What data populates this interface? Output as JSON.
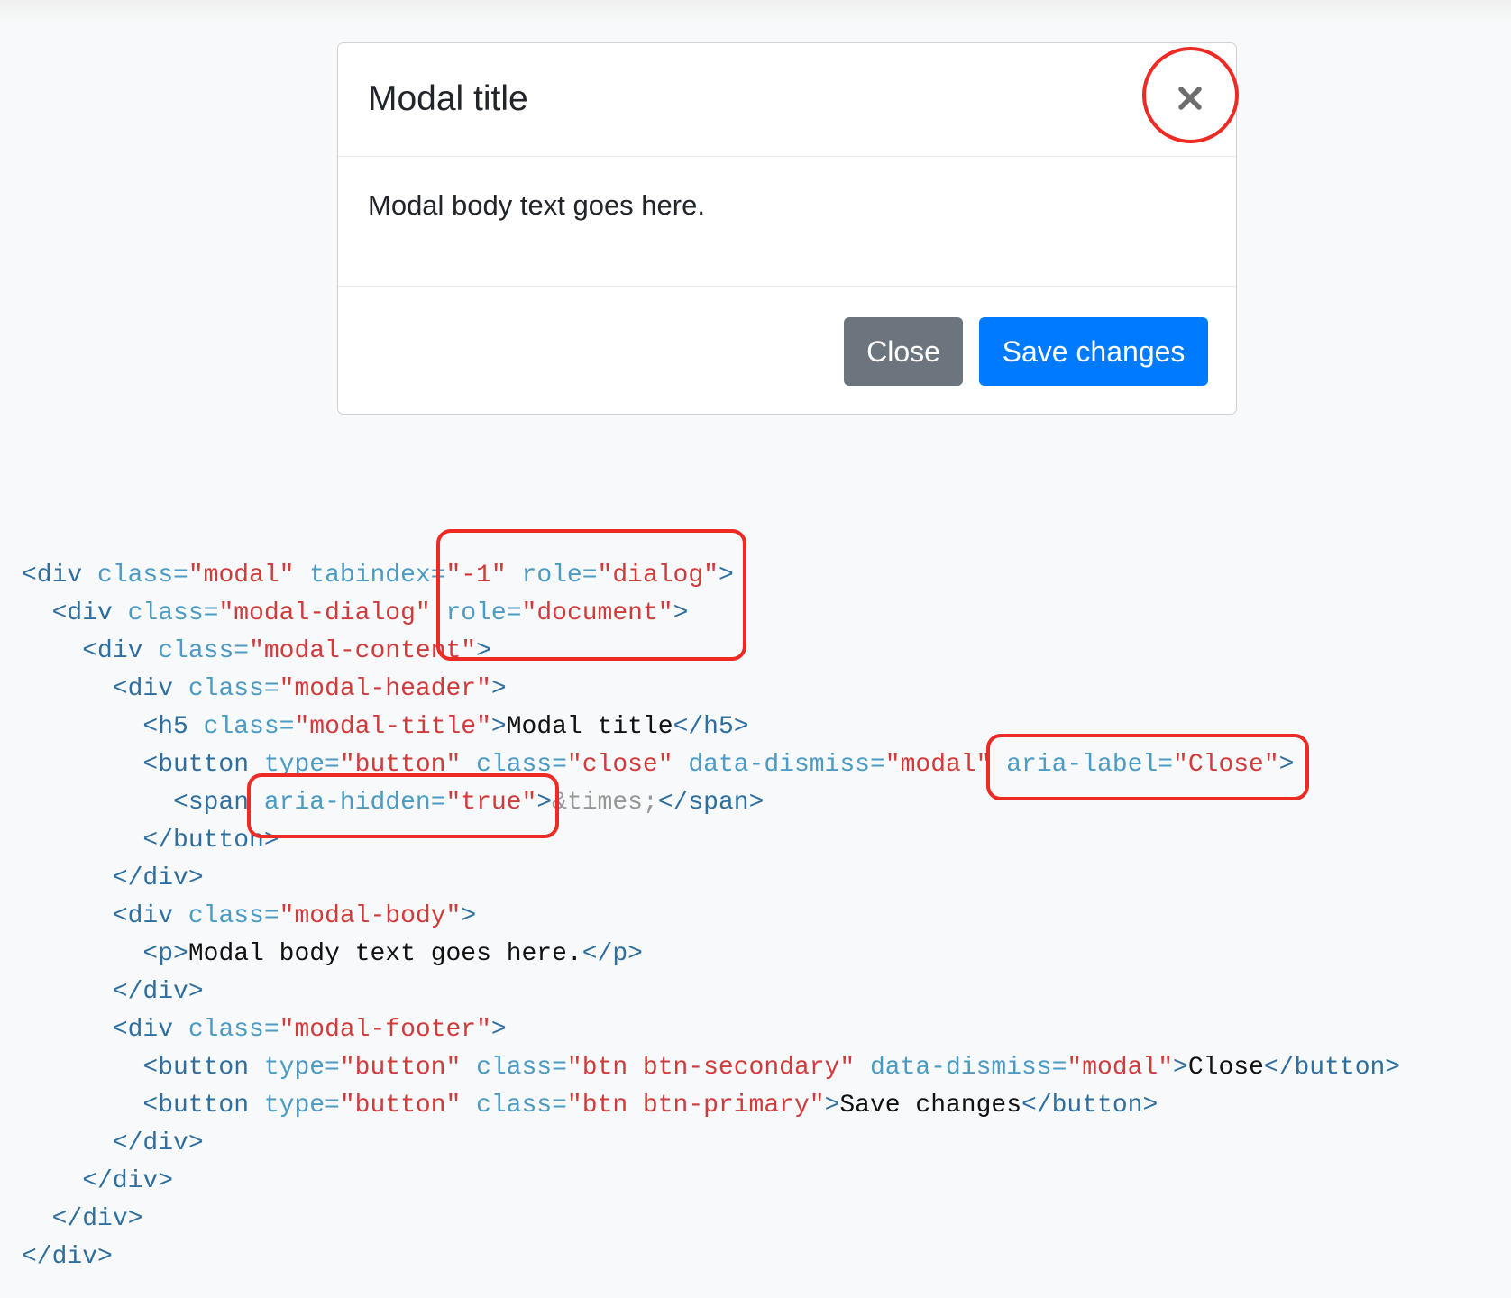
{
  "modal": {
    "title": "Modal title",
    "body_text": "Modal body text goes here.",
    "close_icon": "close-icon",
    "buttons": {
      "close": "Close",
      "save": "Save changes"
    },
    "colors": {
      "secondary": "#6c757d",
      "primary": "#007bff",
      "highlight": "#ee2a24"
    }
  },
  "code": {
    "lines": [
      [
        [
          "t",
          "<div "
        ],
        [
          "a",
          "class="
        ],
        [
          "s",
          "\"modal\""
        ],
        [
          "a",
          " tabindex="
        ],
        [
          "s",
          "\"-1\""
        ],
        [
          "a",
          " role="
        ],
        [
          "s",
          "\"dialog\""
        ],
        [
          "t",
          ">"
        ]
      ],
      [
        [
          "x",
          "  "
        ],
        [
          "t",
          "<div "
        ],
        [
          "a",
          "class="
        ],
        [
          "s",
          "\"modal-dialog\""
        ],
        [
          "a",
          " role="
        ],
        [
          "s",
          "\"document\""
        ],
        [
          "t",
          ">"
        ]
      ],
      [
        [
          "x",
          "    "
        ],
        [
          "t",
          "<div "
        ],
        [
          "a",
          "class="
        ],
        [
          "s",
          "\"modal-content\""
        ],
        [
          "t",
          ">"
        ]
      ],
      [
        [
          "x",
          "      "
        ],
        [
          "t",
          "<div "
        ],
        [
          "a",
          "class="
        ],
        [
          "s",
          "\"modal-header\""
        ],
        [
          "t",
          ">"
        ]
      ],
      [
        [
          "x",
          "        "
        ],
        [
          "t",
          "<h5 "
        ],
        [
          "a",
          "class="
        ],
        [
          "s",
          "\"modal-title\""
        ],
        [
          "t",
          ">"
        ],
        [
          "x",
          "Modal title"
        ],
        [
          "t",
          "</h5>"
        ]
      ],
      [
        [
          "x",
          "        "
        ],
        [
          "t",
          "<button "
        ],
        [
          "a",
          "type="
        ],
        [
          "s",
          "\"button\""
        ],
        [
          "a",
          " class="
        ],
        [
          "s",
          "\"close\""
        ],
        [
          "a",
          " data-dismiss="
        ],
        [
          "s",
          "\"modal\""
        ],
        [
          "a",
          " aria-label="
        ],
        [
          "s",
          "\"Close\""
        ],
        [
          "t",
          ">"
        ]
      ],
      [
        [
          "x",
          "          "
        ],
        [
          "t",
          "<span "
        ],
        [
          "a",
          "aria-hidden="
        ],
        [
          "s",
          "\"true\""
        ],
        [
          "t",
          ">"
        ],
        [
          "e",
          "&times;"
        ],
        [
          "t",
          "</span>"
        ]
      ],
      [
        [
          "x",
          "        "
        ],
        [
          "t",
          "</button>"
        ]
      ],
      [
        [
          "x",
          "      "
        ],
        [
          "t",
          "</div>"
        ]
      ],
      [
        [
          "x",
          "      "
        ],
        [
          "t",
          "<div "
        ],
        [
          "a",
          "class="
        ],
        [
          "s",
          "\"modal-body\""
        ],
        [
          "t",
          ">"
        ]
      ],
      [
        [
          "x",
          "        "
        ],
        [
          "t",
          "<p>"
        ],
        [
          "x",
          "Modal body text goes here."
        ],
        [
          "t",
          "</p>"
        ]
      ],
      [
        [
          "x",
          "      "
        ],
        [
          "t",
          "</div>"
        ]
      ],
      [
        [
          "x",
          "      "
        ],
        [
          "t",
          "<div "
        ],
        [
          "a",
          "class="
        ],
        [
          "s",
          "\"modal-footer\""
        ],
        [
          "t",
          ">"
        ]
      ],
      [
        [
          "x",
          "        "
        ],
        [
          "t",
          "<button "
        ],
        [
          "a",
          "type="
        ],
        [
          "s",
          "\"button\""
        ],
        [
          "a",
          " class="
        ],
        [
          "s",
          "\"btn btn-secondary\""
        ],
        [
          "a",
          " data-dismiss="
        ],
        [
          "s",
          "\"modal\""
        ],
        [
          "t",
          ">"
        ],
        [
          "x",
          "Close"
        ],
        [
          "t",
          "</button>"
        ]
      ],
      [
        [
          "x",
          "        "
        ],
        [
          "t",
          "<button "
        ],
        [
          "a",
          "type="
        ],
        [
          "s",
          "\"button\""
        ],
        [
          "a",
          " class="
        ],
        [
          "s",
          "\"btn btn-primary\""
        ],
        [
          "t",
          ">"
        ],
        [
          "x",
          "Save changes"
        ],
        [
          "t",
          "</button>"
        ]
      ],
      [
        [
          "x",
          "      "
        ],
        [
          "t",
          "</div>"
        ]
      ],
      [
        [
          "x",
          "    "
        ],
        [
          "t",
          "</div>"
        ]
      ],
      [
        [
          "x",
          "  "
        ],
        [
          "t",
          "</div>"
        ]
      ],
      [
        [
          "t",
          "</div>"
        ]
      ]
    ]
  }
}
